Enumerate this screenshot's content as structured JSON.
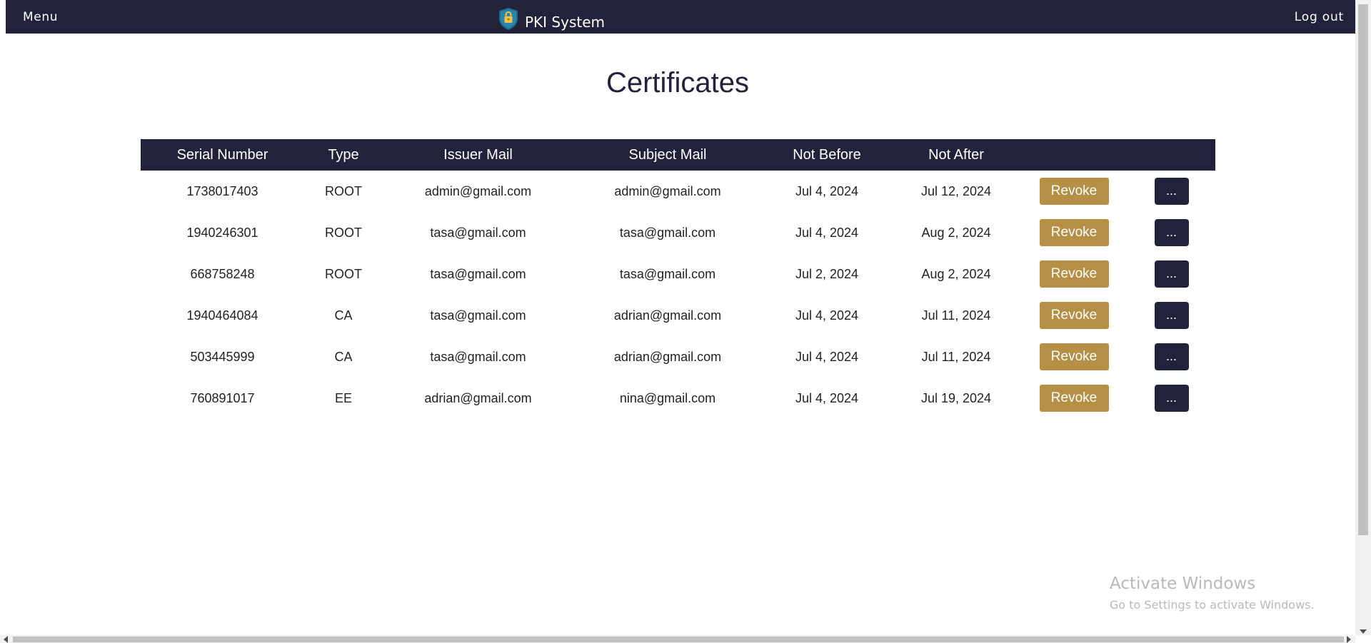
{
  "navbar": {
    "menu_label": "Menu",
    "brand_name": "PKI System",
    "brand_icon": "shield-lock-icon",
    "logout_label": "Log out",
    "bg_color": "#22223a"
  },
  "page": {
    "title": "Certificates"
  },
  "table": {
    "headers": [
      "Serial Number",
      "Type",
      "Issuer Mail",
      "Subject Mail",
      "Not Before",
      "Not After",
      "",
      ""
    ],
    "revoke_label": "Revoke",
    "more_label": "...",
    "revoke_color": "#b58f45",
    "rows": [
      {
        "serial": "1738017403",
        "type": "ROOT",
        "issuer": "admin@gmail.com",
        "subject": "admin@gmail.com",
        "not_before": "Jul 4, 2024",
        "not_after": "Jul 12, 2024"
      },
      {
        "serial": "1940246301",
        "type": "ROOT",
        "issuer": "tasa@gmail.com",
        "subject": "tasa@gmail.com",
        "not_before": "Jul 4, 2024",
        "not_after": "Aug 2, 2024"
      },
      {
        "serial": "668758248",
        "type": "ROOT",
        "issuer": "tasa@gmail.com",
        "subject": "tasa@gmail.com",
        "not_before": "Jul 2, 2024",
        "not_after": "Aug 2, 2024"
      },
      {
        "serial": "1940464084",
        "type": "CA",
        "issuer": "tasa@gmail.com",
        "subject": "adrian@gmail.com",
        "not_before": "Jul 4, 2024",
        "not_after": "Jul 11, 2024"
      },
      {
        "serial": "503445999",
        "type": "CA",
        "issuer": "tasa@gmail.com",
        "subject": "adrian@gmail.com",
        "not_before": "Jul 4, 2024",
        "not_after": "Jul 11, 2024"
      },
      {
        "serial": "760891017",
        "type": "EE",
        "issuer": "adrian@gmail.com",
        "subject": "nina@gmail.com",
        "not_before": "Jul 4, 2024",
        "not_after": "Jul 19, 2024"
      }
    ]
  },
  "watermark": {
    "title": "Activate Windows",
    "subtitle": "Go to Settings to activate Windows."
  }
}
